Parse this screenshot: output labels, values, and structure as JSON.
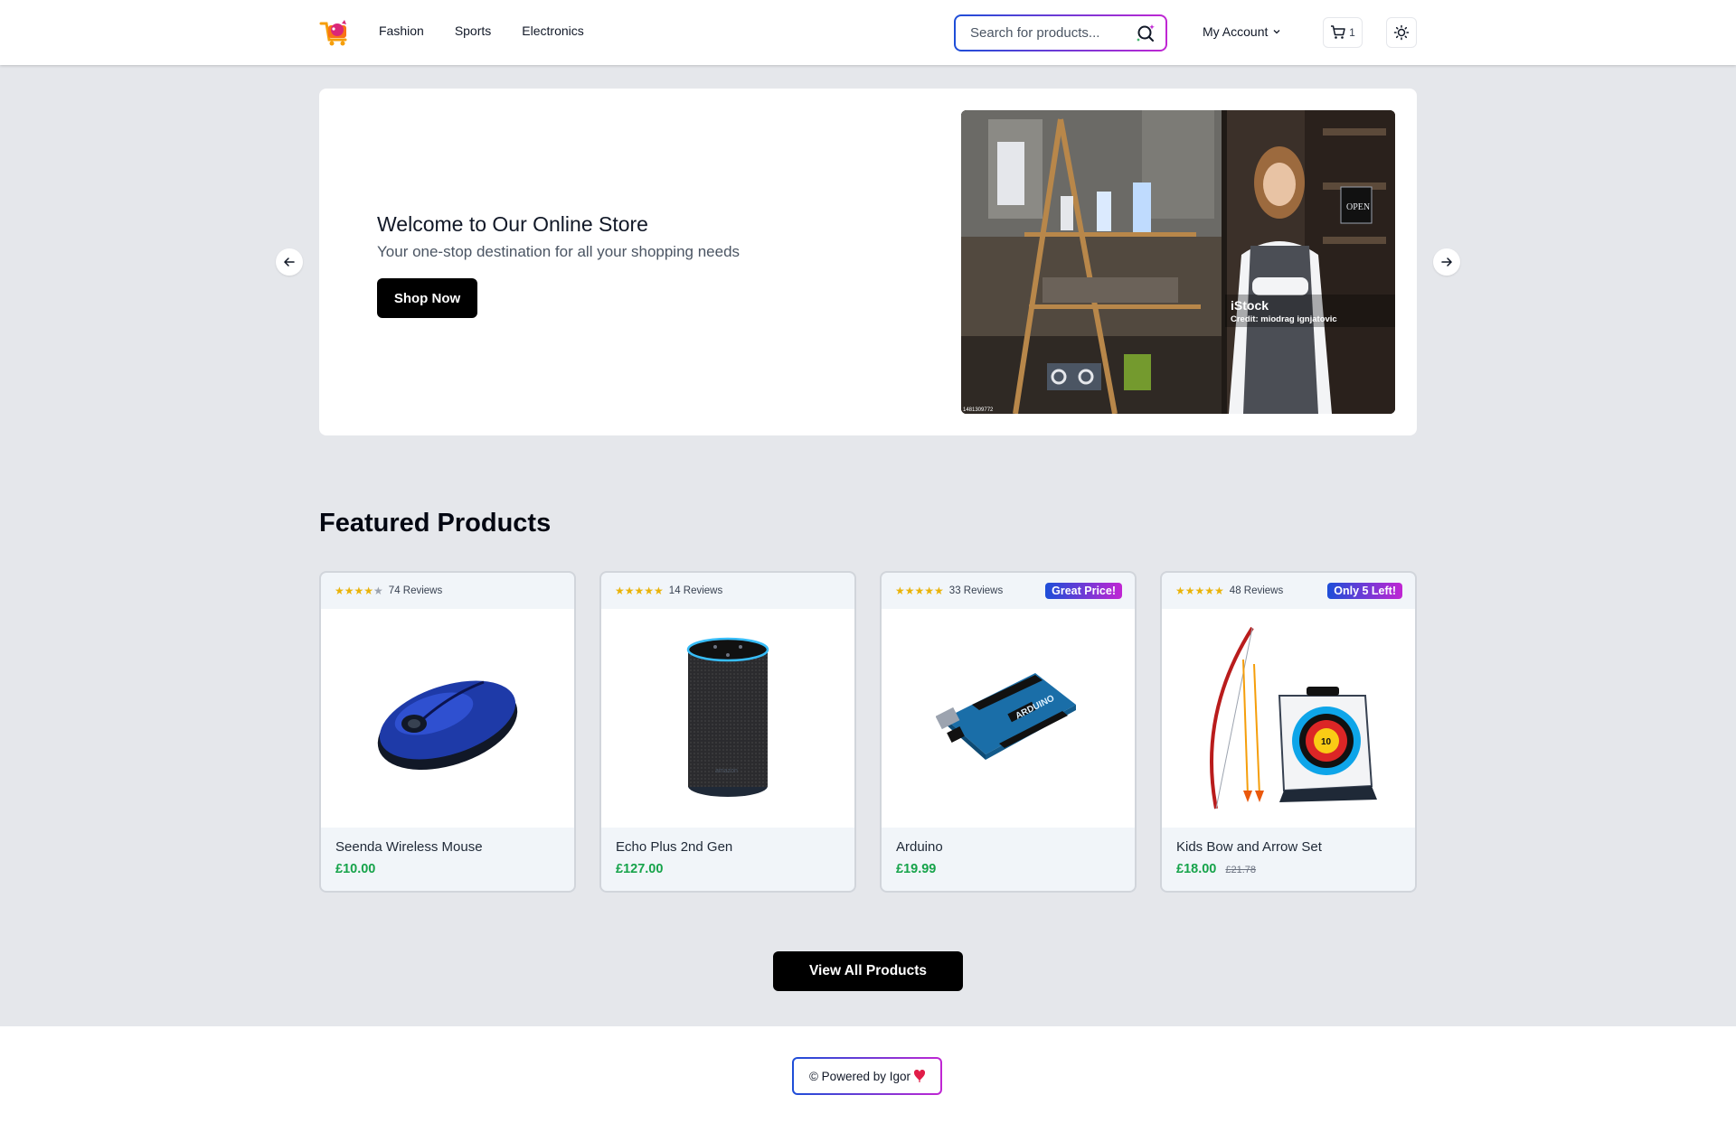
{
  "header": {
    "nav": [
      "Fashion",
      "Sports",
      "Electronics"
    ],
    "search_placeholder": "Search for products...",
    "account_label": "My Account",
    "cart_count": "1"
  },
  "hero": {
    "title": "Welcome to Our Online Store",
    "subtitle": "Your one-stop destination for all your shopping needs",
    "cta": "Shop Now",
    "image_watermark": "iStock",
    "image_credit": "Credit: miodrag ignjatovic",
    "image_id": "1481309772",
    "sign_text": "OPEN"
  },
  "featured": {
    "title": "Featured Products",
    "products": [
      {
        "name": "Seenda Wireless Mouse",
        "price": "£10.00",
        "old_price": "",
        "reviews": "74 Reviews",
        "rating": 4,
        "badge": ""
      },
      {
        "name": "Echo Plus 2nd Gen",
        "price": "£127.00",
        "old_price": "",
        "reviews": "14 Reviews",
        "rating": 5,
        "badge": ""
      },
      {
        "name": "Arduino",
        "price": "£19.99",
        "old_price": "",
        "reviews": "33 Reviews",
        "rating": 5,
        "badge": "Great Price!"
      },
      {
        "name": "Kids Bow and Arrow Set",
        "price": "£18.00",
        "old_price": "£21.78",
        "reviews": "48 Reviews",
        "rating": 5,
        "badge": "Only 5 Left!"
      }
    ],
    "view_all": "View All Products"
  },
  "footer": {
    "powered": "© Powered by Igor"
  },
  "colors": {
    "accent_start": "#1d4ed8",
    "accent_end": "#c026d3",
    "price": "#16a34a",
    "star": "#eab308"
  }
}
